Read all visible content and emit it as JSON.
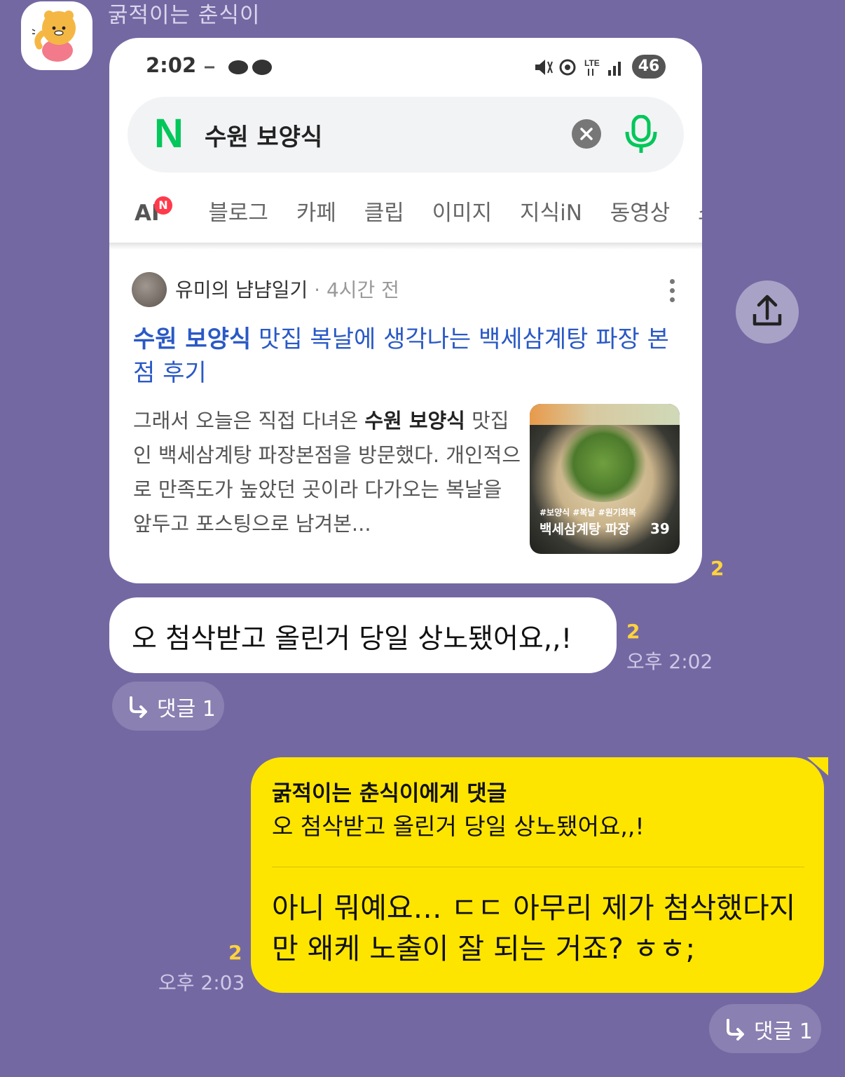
{
  "sender_name": "굵적이는 춘식이",
  "card": {
    "status_bar": {
      "time": "2:02",
      "network": "LTE",
      "battery": "46"
    },
    "search": {
      "query": "수원 보양식"
    },
    "tabs": [
      "AI",
      "블로그",
      "카페",
      "클립",
      "이미지",
      "지식iN",
      "동영상",
      "쇼"
    ],
    "ai_badge": "N",
    "result": {
      "blog_name": "유미의 냠냠일기",
      "posted": "· 4시간 전",
      "title_highlight": "수원 보양식",
      "title_rest": " 맛집 복날에 생각나는 백세삼계탕 파장 본점 후기",
      "excerpt_pre": "그래서 오늘은 직접 다녀온 ",
      "excerpt_bold": "수원 보양식",
      "excerpt_post": " 맛집인 백세삼계탕 파장본점을 방문했다. 개인적으로 만족도가 높았던 곳이라 다가오는 복날을 앞두고 포스팅으로 남겨본...",
      "thumb_tags": "#보양식 #복날 #원기회복",
      "thumb_title": "백세삼계탕 파장",
      "thumb_count": "39"
    }
  },
  "message1": {
    "read_count_card": "2",
    "text": "오 첨삭받고 올린거 당일 상노됐어요,,!",
    "read_count": "2",
    "time": "오후 2:02",
    "reply_label": "댓글 1"
  },
  "message2": {
    "header": "굵적이는 춘식이에게 댓글",
    "quote": "오 첨삭받고 올린거 당일 상노됐어요,,!",
    "text": "아니 뭐예요… ㄷㄷ 아무리 제가 첨삭했다지만 왜케 노출이 잘 되는 거죠? ㅎㅎ;",
    "read_count": "2",
    "time": "오후 2:03",
    "reply_label": "댓글 1"
  },
  "colors": {
    "background": "#7468a3",
    "mine_bubble": "#fee500",
    "read_count": "#ffd43b",
    "naver_green": "#03c75a",
    "link_blue": "#2a59c6"
  }
}
